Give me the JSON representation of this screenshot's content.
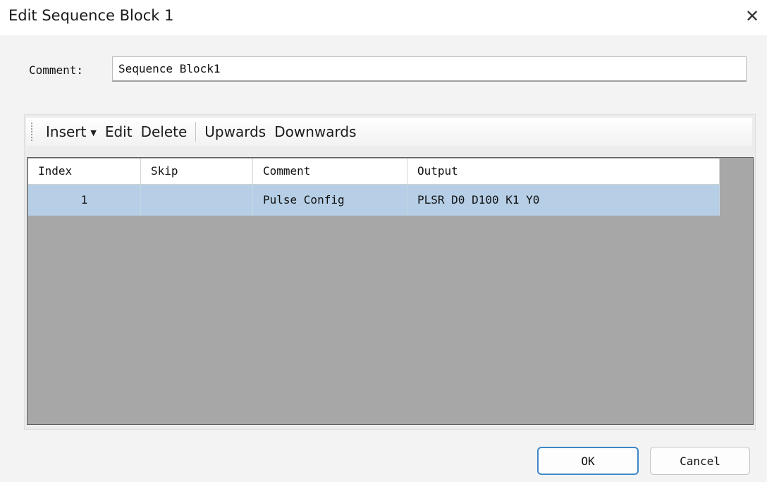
{
  "dialog": {
    "title": "Edit Sequence Block 1",
    "close_icon": "close-icon"
  },
  "comment": {
    "label": "Comment:",
    "value": "Sequence Block1"
  },
  "toolbar": {
    "insert_label": "Insert",
    "edit_label": "Edit",
    "delete_label": "Delete",
    "upwards_label": "Upwards",
    "downwards_label": "Downwards"
  },
  "table": {
    "columns": [
      "Index",
      "Skip",
      "Comment",
      "Output"
    ],
    "rows": [
      {
        "index": "1",
        "skip": "",
        "comment": "Pulse Config",
        "output": "PLSR D0 D100 K1 Y0"
      }
    ],
    "selected_row": 0,
    "selected_color": "#b6cfe6",
    "empty_area_color": "#a7a7a7"
  },
  "buttons": {
    "ok_label": "OK",
    "cancel_label": "Cancel",
    "accent": "#3b87c8"
  }
}
